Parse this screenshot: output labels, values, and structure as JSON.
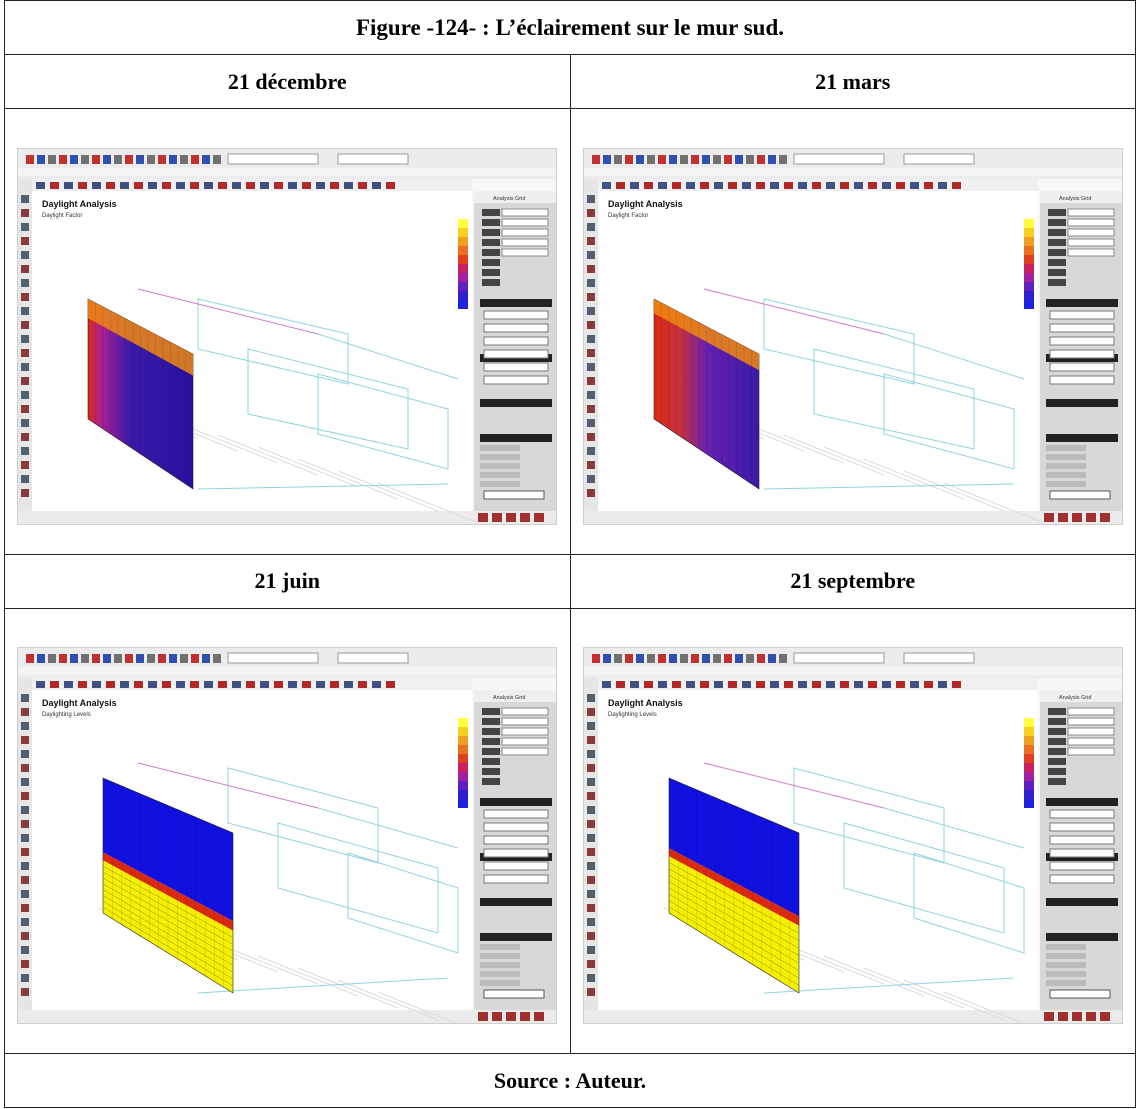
{
  "figure_title": "Figure -124- : L’éclairement sur le mur sud.",
  "source": "Source : Auteur.",
  "panels": [
    {
      "label": "21 décembre",
      "mode": "winter",
      "app_title": "Daylight Analysis",
      "app_subtitle": "Daylight Factor",
      "panel_title": "Analysis Grid"
    },
    {
      "label": "21 mars",
      "mode": "spring",
      "app_title": "Daylight Analysis",
      "app_subtitle": "Daylight Factor",
      "panel_title": "Analysis Grid"
    },
    {
      "label": "21 juin",
      "mode": "summer",
      "app_title": "Daylight Analysis",
      "app_subtitle": "Daylighting Levels",
      "panel_title": "Analysis Grid"
    },
    {
      "label": "21 septembre",
      "mode": "autumn",
      "app_title": "Daylight Analysis",
      "app_subtitle": "Daylighting Levels",
      "panel_title": "Analysis Grid"
    }
  ],
  "colors": {
    "purple": "#3a1aa8",
    "red": "#d92a10",
    "orange": "#f08a10",
    "blue": "#1010e0",
    "yellow": "#f6f000",
    "wire": "#8fd4e0",
    "pink": "#d07ad0"
  }
}
